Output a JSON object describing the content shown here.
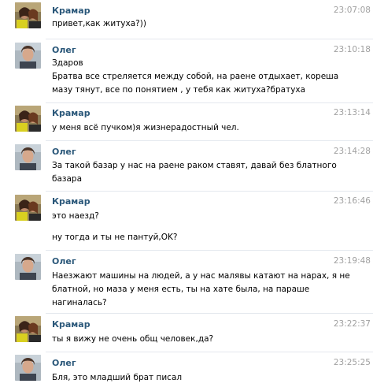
{
  "colors": {
    "sender_name": "#2b587a",
    "timestamp": "#a0a0a0",
    "text": "#000000",
    "separator": "#e4e8ee"
  },
  "messages": [
    {
      "sender": "Крамар",
      "avatar": "kramar-avatar",
      "time": "23:07:08",
      "lines": [
        "привет,как житуха?))"
      ]
    },
    {
      "sender": "Олег",
      "avatar": "oleg-avatar",
      "time": "23:10:18",
      "lines": [
        "Здаров",
        "Братва все стреляется между собой, на раене отдыхает, кореша",
        "мазу тянут, все по понятием , у тебя как житуха?братуха"
      ]
    },
    {
      "sender": "Крамар",
      "avatar": "kramar-avatar",
      "time": "23:13:14",
      "lines": [
        "у меня всё пучком)я жизнерадостный чел."
      ]
    },
    {
      "sender": "Олег",
      "avatar": "oleg-avatar",
      "time": "23:14:28",
      "lines": [
        "За такой базар у нас на раене раком ставят, давай без блатного",
        "базара"
      ]
    },
    {
      "sender": "Крамар",
      "avatar": "kramar-avatar",
      "time": "23:16:46",
      "lines": [
        "это наезд?",
        "ну тогда и ты не пантуй,OK?"
      ]
    },
    {
      "sender": "Олег",
      "avatar": "oleg-avatar",
      "time": "23:19:48",
      "lines": [
        "Наезжают машины на людей, а у нас малявы катают на нарах, я не",
        "блатной, но маза у меня есть, ты на хате была, на параше",
        "нагиналась?"
      ]
    },
    {
      "sender": "Крамар",
      "avatar": "kramar-avatar",
      "time": "23:22:37",
      "lines": [
        "ты я вижу не очень общ человек,да?"
      ]
    },
    {
      "sender": "Олег",
      "avatar": "oleg-avatar",
      "time": "23:25:25",
      "lines": [
        "Бля, это младший брат писал"
      ]
    }
  ]
}
